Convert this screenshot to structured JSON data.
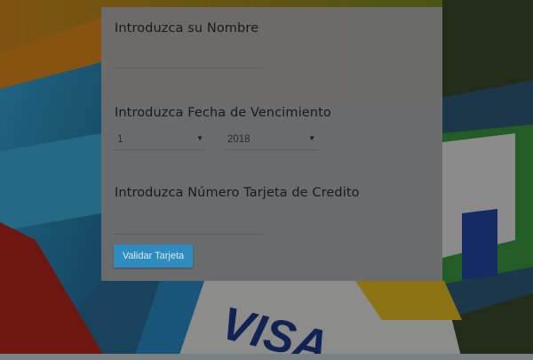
{
  "form": {
    "name_label": "Introduzca su Nombre",
    "name_value": "",
    "expiry_label": "Introduzca Fecha de Vencimiento",
    "month_selected": "1",
    "year_selected": "2018",
    "card_number_label": "Introduzca Número Tarjeta de Credito",
    "card_number_value": "",
    "submit_label": "Validar Tarjeta"
  },
  "background": {
    "card_brand_text": "VISA"
  },
  "colors": {
    "accent": "#2e8cc0",
    "panel": "#6c6c6c"
  },
  "icons": {
    "select_arrow": "caret-down-icon"
  }
}
